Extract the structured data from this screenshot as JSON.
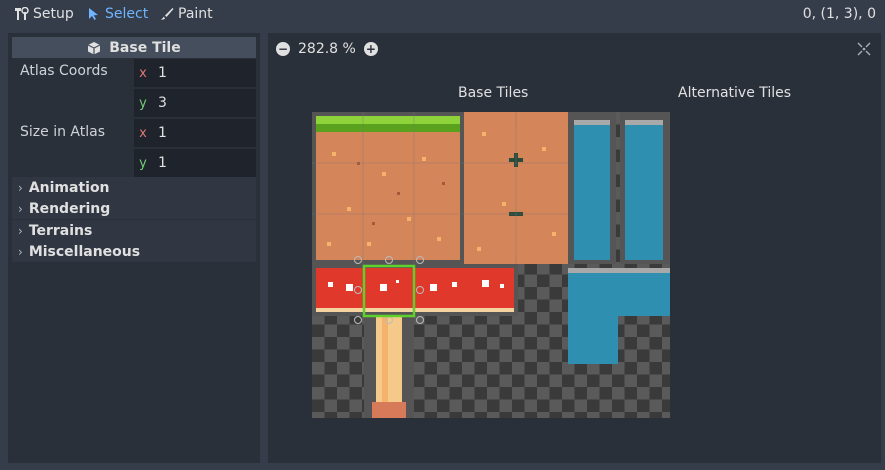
{
  "toolbar": {
    "setup_label": "Setup",
    "select_label": "Select",
    "paint_label": "Paint",
    "active_tool": "Select",
    "coords": "0, (1, 3), 0"
  },
  "inspector": {
    "title": "Base Tile",
    "atlas_coords_label": "Atlas Coords",
    "atlas_x": "1",
    "atlas_y": "3",
    "size_label": "Size in Atlas",
    "size_x": "1",
    "size_y": "1",
    "axis_x": "x",
    "axis_y": "y",
    "groups": [
      "Animation",
      "Rendering",
      "Terrains",
      "Miscellaneous"
    ]
  },
  "viewer": {
    "zoom": "282.8 %",
    "base_tiles_label": "Base Tiles",
    "alternative_tiles_label": "Alternative Tiles"
  },
  "colors": {
    "accent": "#6fb4ff",
    "selection": "#5fd12b",
    "grass": "#8fd33b",
    "dirt": "#d4855a",
    "water": "#2f8fb0",
    "mushroom_red": "#e0382a"
  }
}
